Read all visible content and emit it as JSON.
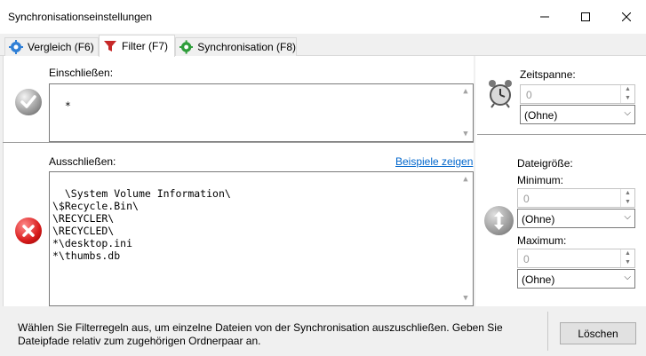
{
  "window": {
    "title": "Synchronisationseinstellungen",
    "minimize": "—",
    "maximize": "☐",
    "close": "✕"
  },
  "tabs": [
    {
      "label": "Vergleich (F6)",
      "icon": "gear-blue-icon",
      "active": false
    },
    {
      "label": "Filter (F7)",
      "icon": "funnel-icon",
      "active": true
    },
    {
      "label": "Synchronisation (F8)",
      "icon": "gear-green-icon",
      "active": false
    }
  ],
  "include": {
    "label": "Einschließen:",
    "value": "*"
  },
  "exclude": {
    "label": "Ausschließen:",
    "examples_link": "Beispiele zeigen",
    "value": "\\System Volume Information\\\n\\$Recycle.Bin\\\n\\RECYCLER\\\n\\RECYCLED\\\n*\\desktop.ini\n*\\thumbs.db"
  },
  "timespan": {
    "label": "Zeitspanne:",
    "value": "0",
    "unit": "(Ohne)"
  },
  "filesize": {
    "label": "Dateigröße:",
    "min_label": "Minimum:",
    "min_value": "0",
    "min_unit": "(Ohne)",
    "max_label": "Maximum:",
    "max_value": "0",
    "max_unit": "(Ohne)"
  },
  "footer": {
    "help_text": "Wählen Sie Filterregeln aus, um einzelne Dateien von der Synchronisation auszuschließen. Geben Sie Dateipfade relativ zum zugehörigen Ordnerpaar an.",
    "clear_button": "Löschen"
  }
}
